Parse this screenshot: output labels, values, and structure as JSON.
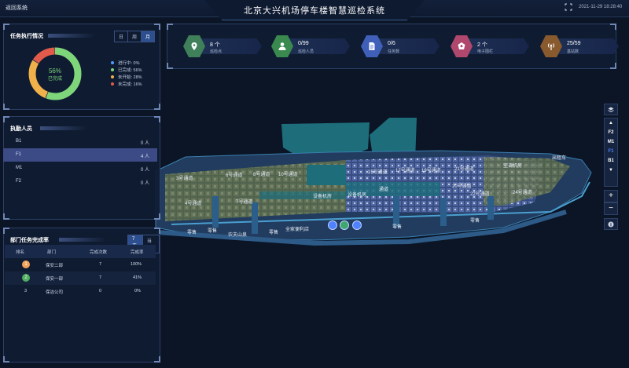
{
  "header": {
    "back_label": "返回系统",
    "title": "北京大兴机场停车楼智慧巡检系统",
    "datetime": "2021-11-29 18:28:40"
  },
  "task_panel": {
    "title": "任务执行情况",
    "period_tabs": [
      "日",
      "周",
      "月"
    ],
    "selected_tab": "月",
    "donut_percent": "56%",
    "donut_label": "已完成",
    "legend": [
      {
        "label": "进行中: 0%",
        "color": "#4f9cff",
        "value": 0
      },
      {
        "label": "已完成: 56%",
        "color": "#7fd67a",
        "value": 56
      },
      {
        "label": "未开始: 28%",
        "color": "#f0b04a",
        "value": 28
      },
      {
        "label": "未完成: 16%",
        "color": "#e25a4a",
        "value": 16
      }
    ]
  },
  "personnel_panel": {
    "title": "执勤人员",
    "rows": [
      {
        "floor": "B1",
        "count": "0 人"
      },
      {
        "floor": "F1",
        "count": "4 人"
      },
      {
        "floor": "M1",
        "count": "0 人"
      },
      {
        "floor": "F2",
        "count": "0 人"
      }
    ],
    "selected_index": 1
  },
  "dept_panel": {
    "title": "部门任务完成率",
    "period_tabs": [
      "7天",
      "当月"
    ],
    "selected_tab": "7天",
    "columns": [
      "排名",
      "部门",
      "完成次数",
      "完成率"
    ],
    "rows": [
      {
        "rank": "1",
        "dept": "保安二部",
        "count": "7",
        "rate": "100%",
        "rank_color": "#f0a35a"
      },
      {
        "rank": "2",
        "dept": "保安一部",
        "count": "7",
        "rate": "41%",
        "rank_color": "#4fae5f"
      },
      {
        "rank": "3",
        "dept": "保洁公司",
        "count": "0",
        "rate": "0%",
        "rank_color": ""
      }
    ]
  },
  "stats": [
    {
      "value": "8 个",
      "label": "巡检点",
      "icon": "location-pin-icon",
      "color": "#3f7f5a"
    },
    {
      "value": "0/99",
      "label": "巡检人员",
      "icon": "person-icon",
      "color": "#3a8a4f"
    },
    {
      "value": "0/6",
      "label": "任务数",
      "icon": "document-icon",
      "color": "#3f5fb8"
    },
    {
      "value": "2 个",
      "label": "电子围栏",
      "icon": "fence-icon",
      "color": "#b0486e"
    },
    {
      "value": "25/59",
      "label": "基站数",
      "icon": "antenna-icon",
      "color": "#8a5a2f"
    }
  ],
  "floor_selector": {
    "floors": [
      "F2",
      "M1",
      "F1",
      "B1"
    ],
    "selected": "F1"
  },
  "map_labels": [
    "3号通道",
    "4号通道",
    "6号通道",
    "7号通道",
    "8号通道",
    "10号通道",
    "15号通道",
    "17号通道",
    "19号通道",
    "21号通道",
    "20号通道",
    "22号通道",
    "24号通道",
    "设备机房",
    "设备机房",
    "通道",
    "空调机房",
    "零售",
    "零售",
    "零售",
    "零售",
    "零售",
    "全家便利店",
    "农夫山泉",
    "出租车"
  ]
}
